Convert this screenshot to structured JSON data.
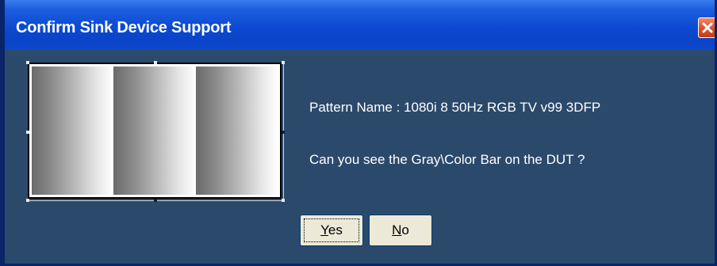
{
  "window": {
    "title": "Confirm Sink Device Support"
  },
  "dialog": {
    "pattern_line": "Pattern Name : 1080i 8 50Hz RGB TV v99 3DFP",
    "question": "Can you see the Gray\\Color Bar on the DUT ?",
    "buttons": {
      "yes": {
        "first": "Y",
        "rest": "es"
      },
      "no": {
        "first": "N",
        "rest": "o"
      }
    }
  },
  "icons": {
    "close": "close-icon",
    "preview": "gray-bar-pattern-image"
  },
  "colors": {
    "titlebar": "#0b4ad2",
    "client_bg": "#2b4a6b",
    "close_button": "#e0532a",
    "button_face": "#ece9d8"
  }
}
